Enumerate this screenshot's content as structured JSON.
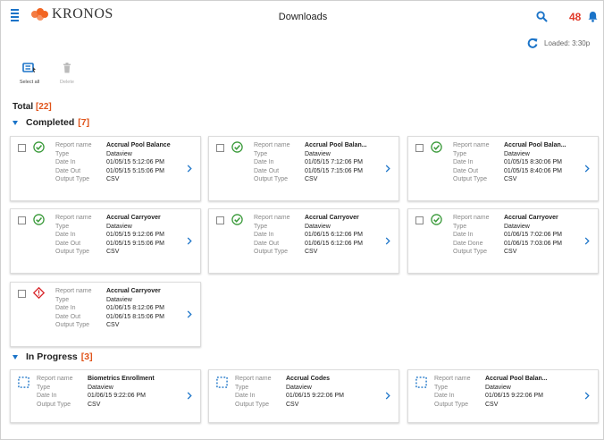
{
  "app": {
    "logo_text": "KRONOS",
    "title": "Downloads",
    "notification_count": "48",
    "loaded_text": "Loaded: 3:30p",
    "accent": "#1a73c8",
    "brand": "#f26522"
  },
  "toolbar": {
    "select_all_label": "Select all",
    "delete_label": "Delete"
  },
  "summary": {
    "total_label": "Total",
    "total_count": "[22]"
  },
  "completed": {
    "label": "Completed",
    "count": "[7]",
    "cards": [
      {
        "status": "success",
        "rows": [
          {
            "label": "Report name",
            "value": "Accrual Pool Balance"
          },
          {
            "label": "Type",
            "value": "Dataview"
          },
          {
            "label": "Date In",
            "value": "01/05/15  5:12:06 PM"
          },
          {
            "label": "Date Out",
            "value": "01/05/15  5:15:06 PM"
          },
          {
            "label": "Output Type",
            "value": "CSV"
          }
        ]
      },
      {
        "status": "success",
        "rows": [
          {
            "label": "Report name",
            "value": "Accrual Pool Balan..."
          },
          {
            "label": "Type",
            "value": "Dataview"
          },
          {
            "label": "Date In",
            "value": "01/05/15  7:12:06 PM"
          },
          {
            "label": "Date Out",
            "value": "01/05/15  7:15:06 PM"
          },
          {
            "label": "Output Type",
            "value": "CSV"
          }
        ]
      },
      {
        "status": "success",
        "rows": [
          {
            "label": "Report name",
            "value": "Accrual Pool Balan..."
          },
          {
            "label": "Type",
            "value": "Dataview"
          },
          {
            "label": "Date In",
            "value": "01/05/15  8:30:06 PM"
          },
          {
            "label": "Date Out",
            "value": "01/05/15  8:40:06 PM"
          },
          {
            "label": "Output Type",
            "value": "CSV"
          }
        ]
      },
      {
        "status": "success",
        "rows": [
          {
            "label": "Report name",
            "value": "Accrual Carryover"
          },
          {
            "label": "Type",
            "value": "Dataview"
          },
          {
            "label": "Date In",
            "value": "01/05/15  9:12:06 PM"
          },
          {
            "label": "Date Out",
            "value": "01/05/15  9:15:06 PM"
          },
          {
            "label": "Output Type",
            "value": "CSV"
          }
        ]
      },
      {
        "status": "success",
        "rows": [
          {
            "label": "Report name",
            "value": "Accrual Carryover"
          },
          {
            "label": "Type",
            "value": "Dataview"
          },
          {
            "label": "Date In",
            "value": "01/06/15  6:12:06 PM"
          },
          {
            "label": "Date Out",
            "value": "01/06/15  6:12:06 PM"
          },
          {
            "label": "Output Type",
            "value": "CSV"
          }
        ]
      },
      {
        "status": "success",
        "rows": [
          {
            "label": "Report name",
            "value": "Accrual Carryover"
          },
          {
            "label": "Type",
            "value": "Dataview"
          },
          {
            "label": "Date In",
            "value": "01/06/15  7:02:06 PM"
          },
          {
            "label": "Date Done",
            "value": "01/06/15  7:03:06 PM"
          },
          {
            "label": "Output Type",
            "value": "CSV"
          }
        ]
      },
      {
        "status": "error",
        "rows": [
          {
            "label": "Report name",
            "value": "Accrual Carryover"
          },
          {
            "label": "Type",
            "value": "Dataview"
          },
          {
            "label": "Date In",
            "value": "01/06/15  8:12:06 PM"
          },
          {
            "label": "Date Out",
            "value": "01/06/15  8:15:06 PM"
          },
          {
            "label": "Output Type",
            "value": "CSV"
          }
        ]
      }
    ]
  },
  "in_progress": {
    "label": "In Progress",
    "count": "[3]",
    "cards": [
      {
        "rows": [
          {
            "label": "Report name",
            "value": "Biometrics Enrollment"
          },
          {
            "label": "Type",
            "value": "Dataview"
          },
          {
            "label": "Date In",
            "value": "01/06/15  9:22:06 PM"
          },
          {
            "label": "Output Type",
            "value": "CSV"
          }
        ]
      },
      {
        "rows": [
          {
            "label": "Report name",
            "value": "Accrual Codes"
          },
          {
            "label": "Type",
            "value": "Dataview"
          },
          {
            "label": "Date In",
            "value": "01/06/15  9:22:06 PM"
          },
          {
            "label": "Output Type",
            "value": "CSV"
          }
        ]
      },
      {
        "rows": [
          {
            "label": "Report name",
            "value": "Accrual Pool Balan..."
          },
          {
            "label": "Type",
            "value": "Dataview"
          },
          {
            "label": "Date In",
            "value": "01/06/15  9:22:06 PM"
          },
          {
            "label": "Output Type",
            "value": "CSV"
          }
        ]
      }
    ]
  }
}
